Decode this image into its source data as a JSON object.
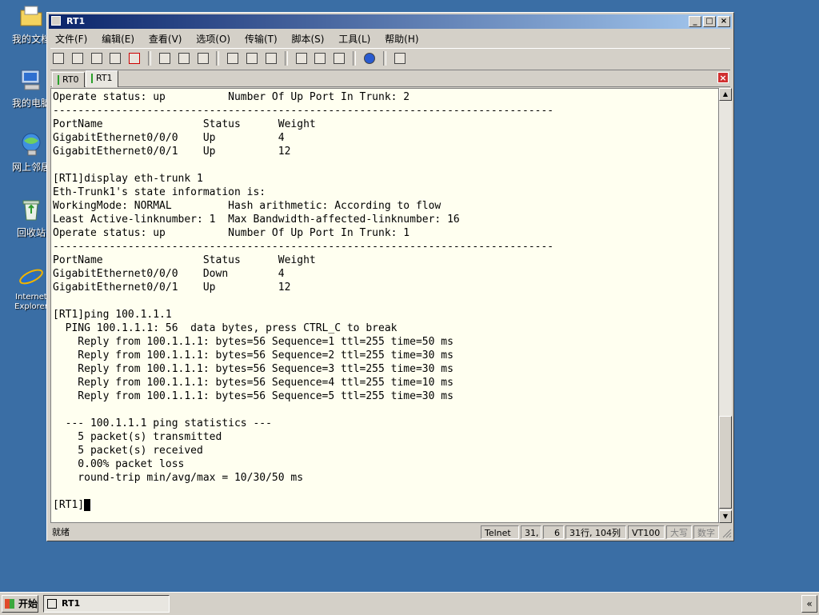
{
  "desktop": {
    "icons": [
      {
        "label": "我的文档",
        "icon": "folder-icon"
      },
      {
        "label": "我的电脑",
        "icon": "computer-icon"
      },
      {
        "label": "网上邻居",
        "icon": "network-icon"
      },
      {
        "label": "回收站",
        "icon": "recycle-bin-icon"
      },
      {
        "label": "Internet Explorer",
        "icon": "ie-icon"
      }
    ]
  },
  "window": {
    "title": "RT1",
    "buttons": {
      "minimize": "_",
      "maximize": "□",
      "close": "×"
    }
  },
  "menu": [
    {
      "label": "文件(F)"
    },
    {
      "label": "编辑(E)"
    },
    {
      "label": "查看(V)"
    },
    {
      "label": "选项(O)"
    },
    {
      "label": "传输(T)"
    },
    {
      "label": "脚本(S)"
    },
    {
      "label": "工具(L)"
    },
    {
      "label": "帮助(H)"
    }
  ],
  "tabs": [
    {
      "label": "RT0",
      "active": false
    },
    {
      "label": "RT1",
      "active": true
    }
  ],
  "terminal": {
    "lines": [
      "Operate status: up          Number Of Up Port In Trunk: 2",
      "--------------------------------------------------------------------------------",
      "PortName                Status      Weight",
      "GigabitEthernet0/0/0    Up          4",
      "GigabitEthernet0/0/1    Up          12",
      "",
      "[RT1]display eth-trunk 1",
      "Eth-Trunk1's state information is:",
      "WorkingMode: NORMAL         Hash arithmetic: According to flow",
      "Least Active-linknumber: 1  Max Bandwidth-affected-linknumber: 16",
      "Operate status: up          Number Of Up Port In Trunk: 1",
      "--------------------------------------------------------------------------------",
      "PortName                Status      Weight",
      "GigabitEthernet0/0/0    Down        4",
      "GigabitEthernet0/0/1    Up          12",
      "",
      "[RT1]ping 100.1.1.1",
      "  PING 100.1.1.1: 56  data bytes, press CTRL_C to break",
      "    Reply from 100.1.1.1: bytes=56 Sequence=1 ttl=255 time=50 ms",
      "    Reply from 100.1.1.1: bytes=56 Sequence=2 ttl=255 time=30 ms",
      "    Reply from 100.1.1.1: bytes=56 Sequence=3 ttl=255 time=30 ms",
      "    Reply from 100.1.1.1: bytes=56 Sequence=4 ttl=255 time=10 ms",
      "    Reply from 100.1.1.1: bytes=56 Sequence=5 ttl=255 time=30 ms",
      "",
      "  --- 100.1.1.1 ping statistics ---",
      "    5 packet(s) transmitted",
      "    5 packet(s) received",
      "    0.00% packet loss",
      "    round-trip min/avg/max = 10/30/50 ms",
      "",
      "[RT1]"
    ]
  },
  "status": {
    "ready": "就绪",
    "protocol": "Telnet",
    "row": "31,",
    "col": "6",
    "size": "31行, 104列",
    "term_type": "VT100",
    "caps": "大写",
    "num": "数字"
  },
  "taskbar": {
    "start": "开始",
    "task": "RT1",
    "tray_toggle": "«"
  }
}
